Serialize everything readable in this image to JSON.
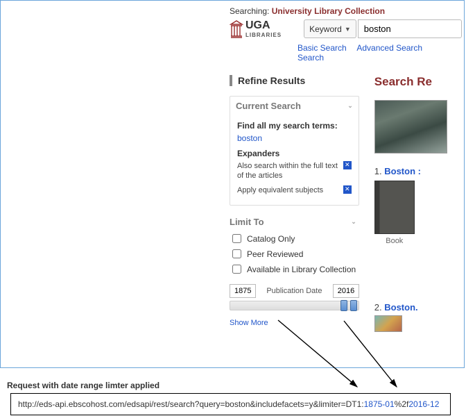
{
  "header": {
    "searching_prefix": "Searching: ",
    "collection": "University Library Collection",
    "logo_main": "UGA",
    "logo_sub": "LIBRARIES",
    "dropdown_label": "Keyword",
    "search_value": "boston",
    "link_basic": "Basic Search",
    "link_advanced": "Advanced Search",
    "link_search": "Search"
  },
  "sidebar": {
    "refine_title": "Refine Results",
    "current_search_title": "Current Search",
    "find_terms_label": "Find all my search terms:",
    "term": "boston",
    "expanders_title": "Expanders",
    "expanders": [
      {
        "label": "Also search within the full text of the articles"
      },
      {
        "label": "Apply equivalent subjects"
      }
    ],
    "limit_to_title": "Limit To",
    "limits": [
      {
        "label": "Catalog Only"
      },
      {
        "label": "Peer Reviewed"
      },
      {
        "label": "Available in Library Collection"
      }
    ],
    "date_from": "1875",
    "date_label": "Publication Date",
    "date_to": "2016",
    "show_more": "Show More"
  },
  "results": {
    "title": "Search Re",
    "item1_num": "1. ",
    "item1_link": "Boston :",
    "item1_caption": "Book",
    "item2_num": "2. ",
    "item2_link": "Boston."
  },
  "footer": {
    "caption": "Request with date range limter applied",
    "url_p1": "http://eds-api.ebscohost.com/edsapi/rest/search?query=boston&includefacets=y&limiter=DT1:",
    "url_hl1": "1875-01",
    "url_p2": "%2f",
    "url_hl2": "2016-12"
  }
}
